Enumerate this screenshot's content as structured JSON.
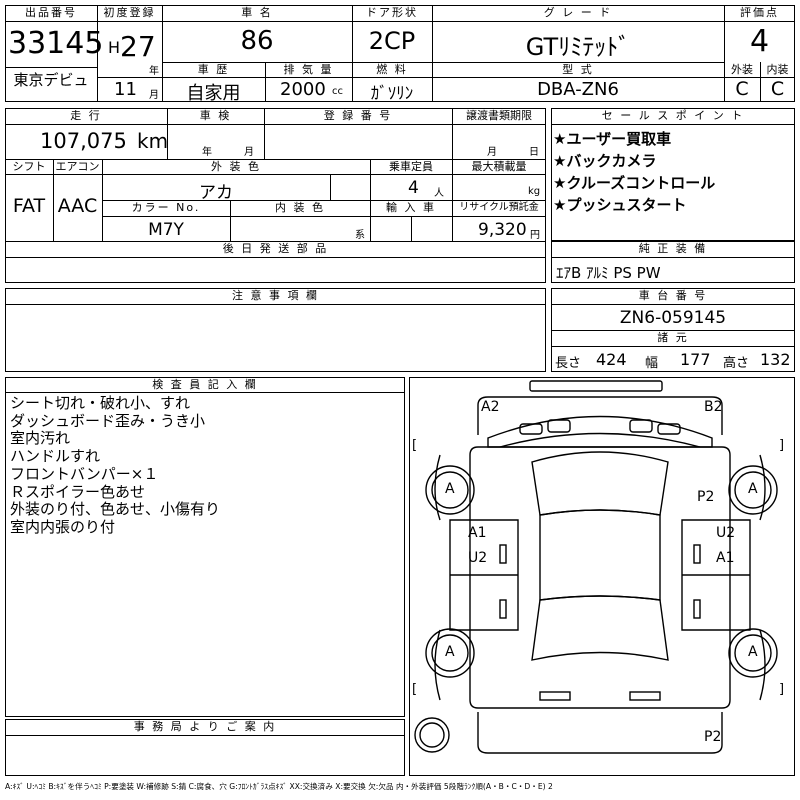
{
  "header": {
    "lot_number_label": "出品番号",
    "lot_number": "33145",
    "debut_label": "東京デビュ",
    "first_reg_label": "初度登録",
    "era_letter": "H",
    "first_reg_year": "27",
    "year_unit": "年",
    "first_reg_month": "11",
    "month_unit": "月",
    "car_name_label": "車 名",
    "car_name": "86",
    "history_label": "車 歴",
    "history": "自家用",
    "displacement_label": "排 気 量",
    "displacement": "2000",
    "displacement_unit": "cc",
    "door_label": "ドア形状",
    "door": "2CP",
    "fuel_label": "燃 料",
    "fuel": "ｶﾞｿﾘﾝ",
    "grade_label": "グ レ ー ド",
    "grade": "GTﾘﾐﾃｯﾄﾞ",
    "model_code_label": "型 式",
    "model_code": "DBA-ZN6",
    "score_label": "評価点",
    "score": "4",
    "exterior_label": "外装",
    "exterior": "C",
    "interior_label": "内装",
    "interior": "C"
  },
  "details": {
    "mileage_label": "走 行",
    "mileage": "107,075",
    "mileage_unit": "km",
    "inspection_label": "車 検",
    "inspection_year_unit": "年",
    "inspection_month_unit": "月",
    "plate_label": "登 録 番 号",
    "transfer_label": "譲渡書類期限",
    "transfer_month_unit": "月",
    "transfer_day_unit": "日",
    "shift_label": "シフト",
    "shift": "FAT",
    "ac_label": "エアコン",
    "ac": "AAC",
    "color_label": "外 装 色",
    "color": "アカ",
    "capacity_label": "乗車定員",
    "capacity": "4",
    "capacity_unit": "人",
    "load_label": "最大積載量",
    "load_unit": "kg",
    "color_no_label": "カラー No.",
    "color_no": "M7Y",
    "interior_color_label": "内 装 色",
    "interior_color_unit": "系",
    "import_label": "輸 入 車",
    "recycle_label": "リサイクル預託金",
    "recycle": "9,320",
    "recycle_unit": "円",
    "later_parts_label": "後 日 発 送 部 品"
  },
  "sales": {
    "label": "セ ー ル ス ポ イ ン ト",
    "points": [
      "★ユーザー買取車",
      "★バックカメラ",
      "★クルーズコントロール",
      "★プッシュスタート"
    ]
  },
  "equipment": {
    "label": "純 正 装 備",
    "items": "ｴｱB ｱﾙﾐ PS PW"
  },
  "caution": {
    "label": "注 意 事 項 欄"
  },
  "chassis": {
    "label": "車 台 番 号",
    "number": "ZN6-059145",
    "specs_label": "諸 元",
    "length_label": "長さ",
    "length": "424",
    "width_label": "幅",
    "width": "177",
    "height_label": "高さ",
    "height": "132"
  },
  "inspector": {
    "label": "検 査 員 記 入 欄",
    "notes": [
      "シート切れ・破れ小、すれ",
      "ダッシュボード歪み・うき小",
      "室内汚れ",
      "ハンドルすれ",
      "フロントバンパー×１",
      "Ｒスポイラー色あせ",
      "外装のり付、色あせ、小傷有り",
      "室内内張のり付"
    ]
  },
  "office": {
    "label": "事 務 局 よ り ご 案 内"
  },
  "diagram": {
    "labels": {
      "front_left": "A2",
      "front_right": "B2",
      "right_fender": "P2",
      "left_door_1": "A1",
      "left_door_2": "U2",
      "right_door_1": "U2",
      "right_door_2": "A1",
      "rear": "P2",
      "tire": "A"
    },
    "bracket": "[",
    "bracket_close": "]"
  },
  "legend": "A:ｷｽﾞ U:ﾍｺﾐ B:ｷｽﾞを伴うﾍｺﾐ P:要塗装 W:補修跡 S:錆 C:腐食、穴 G:ﾌﾛﾝﾄｶﾞﾗｽ点ｷｽﾞ XX:交換済み X:要交換 欠:欠品 内・外装評価 5段階ﾗﾝｸ順(A・B・C・D・E) 2"
}
